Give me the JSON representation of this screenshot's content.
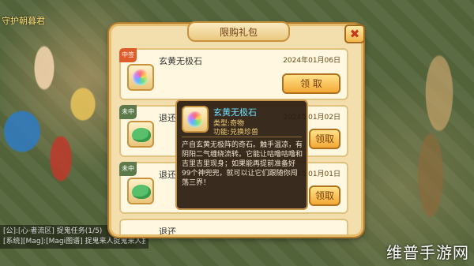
{
  "scene": {
    "top_left_name": "守护朝暮君",
    "chat_lines": [
      "[公]:[心·者流区] 捉鬼任务(1/5)",
      "[系统][Mag]:[Magi图谱] 捉鬼来人捉鬼来人按"
    ]
  },
  "panel": {
    "title": "限购礼包",
    "close_label": "✖",
    "rows": [
      {
        "status": "中签",
        "name": "玄黄无极石",
        "date": "2024年01月06日",
        "action": "领 取"
      },
      {
        "status": "未中签",
        "name": "退还",
        "date": "2024年01月02日",
        "action": "领取"
      },
      {
        "status": "未中签",
        "name": "退还",
        "date": "2024年01月01日",
        "action": "领取"
      },
      {
        "status": "",
        "name": "退还",
        "date": "",
        "action": ""
      }
    ]
  },
  "tooltip": {
    "name": "玄黄无极石",
    "type_line": "类型:奇物",
    "func_line": "功能:兑换珍兽",
    "description": "产自玄黄无极阵的奇石。触手温凉，有阴阳二气缠绕流转。它能让咕噜咕噜和吉里吉里现身；如果能再提前准备好99个神兜兜，就可以让它们跟随你闯荡三界！"
  },
  "watermark": "维普手游网"
}
